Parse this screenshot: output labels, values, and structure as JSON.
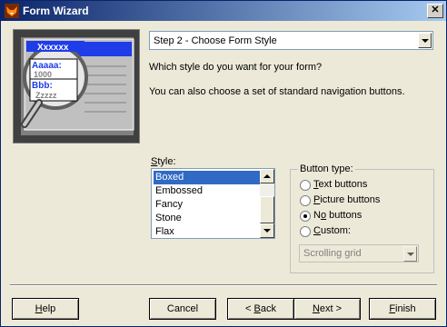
{
  "window": {
    "title": "Form Wizard",
    "close_glyph": "✕"
  },
  "preview": {
    "title_text": "Xxxxxx",
    "field_a_label": "Aaaaa:",
    "field_a_value": "1000",
    "field_b_label": "Bbb:",
    "field_b_value": "Zzzzz"
  },
  "step_select": {
    "value": "Step 2 - Choose Form Style"
  },
  "prompt": "Which style do you want for your form?",
  "subprompt": "You can also choose a set of standard navigation buttons.",
  "style": {
    "label": "Style:",
    "items": [
      {
        "label": "Boxed",
        "selected": true
      },
      {
        "label": "Embossed",
        "selected": false
      },
      {
        "label": "Fancy",
        "selected": false
      },
      {
        "label": "Stone",
        "selected": false
      },
      {
        "label": "Flax",
        "selected": false
      }
    ]
  },
  "button_type": {
    "legend": "Button type:",
    "options": [
      {
        "label": "Text buttons",
        "checked": false
      },
      {
        "label": "Picture buttons",
        "checked": false
      },
      {
        "label": "No buttons",
        "checked": true
      },
      {
        "label": "Custom:",
        "checked": false
      }
    ],
    "custom_select_value": "Scrolling grid"
  },
  "buttons": {
    "help": "Help",
    "cancel": "Cancel",
    "back": "< Back",
    "next": "Next >",
    "finish": "Finish"
  },
  "colors": {
    "selection": "#316ac5",
    "titlebar": "#0a246a",
    "preview_blue": "#1e3ce8"
  }
}
